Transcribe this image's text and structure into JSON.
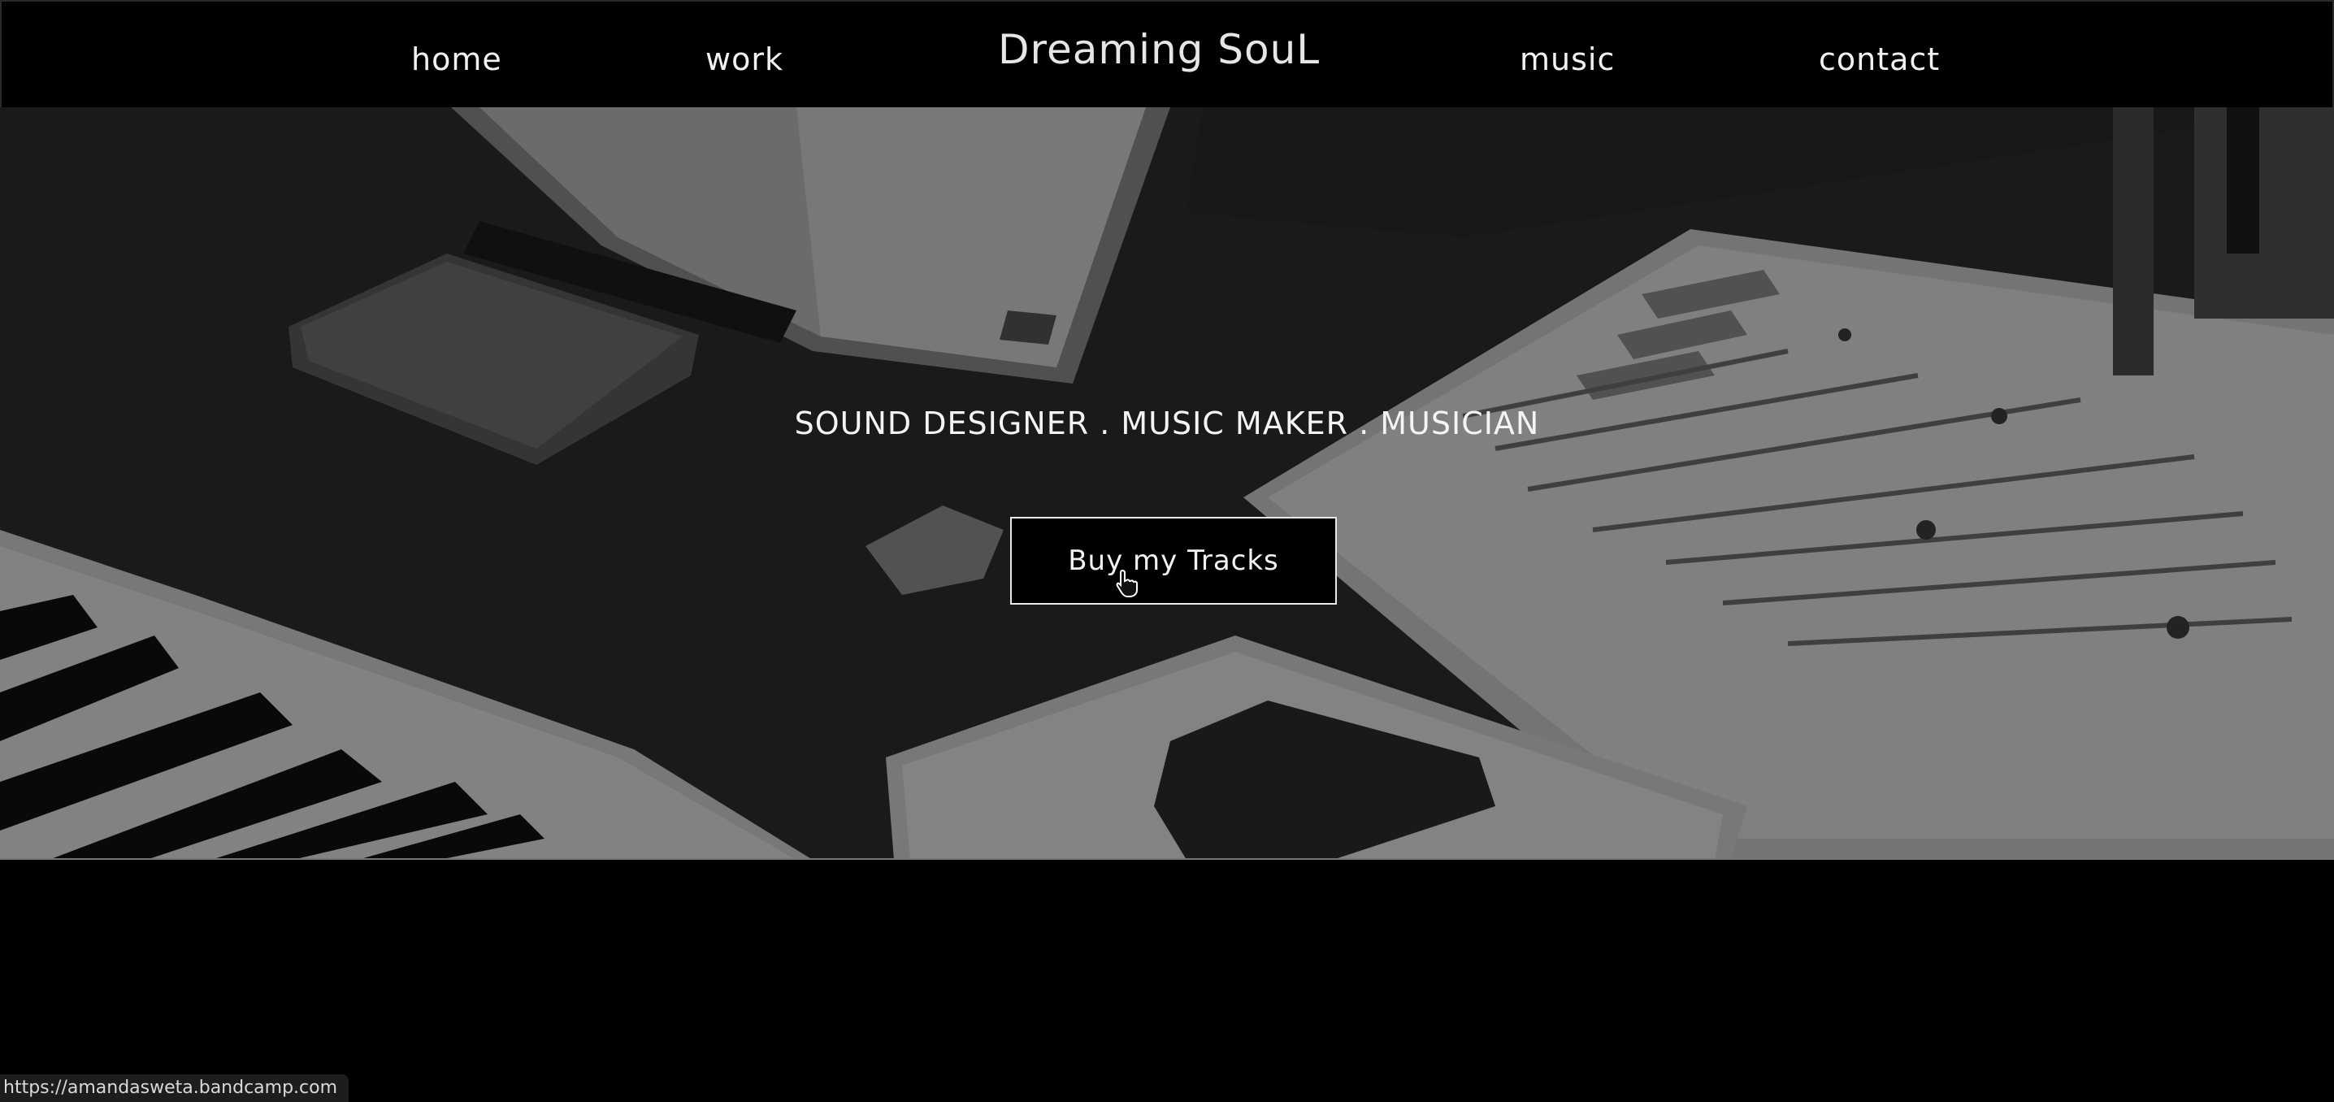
{
  "nav": {
    "home_label": "home",
    "work_label": "work",
    "brand": "Dreaming SouL",
    "music_label": "music",
    "contact_label": "contact"
  },
  "hero": {
    "tagline": "SOUND DESIGNER . MUSIC MAKER . MUSICIAN",
    "cta_label": "Buy my Tracks"
  },
  "status_bar": {
    "url": "https://amandasweta.bandcamp.com"
  },
  "colors": {
    "background": "#000000",
    "text": "#f2f2f2",
    "hero_tint": "#2b2b2b"
  },
  "icons": {
    "cursor": "hand-pointer-icon"
  }
}
